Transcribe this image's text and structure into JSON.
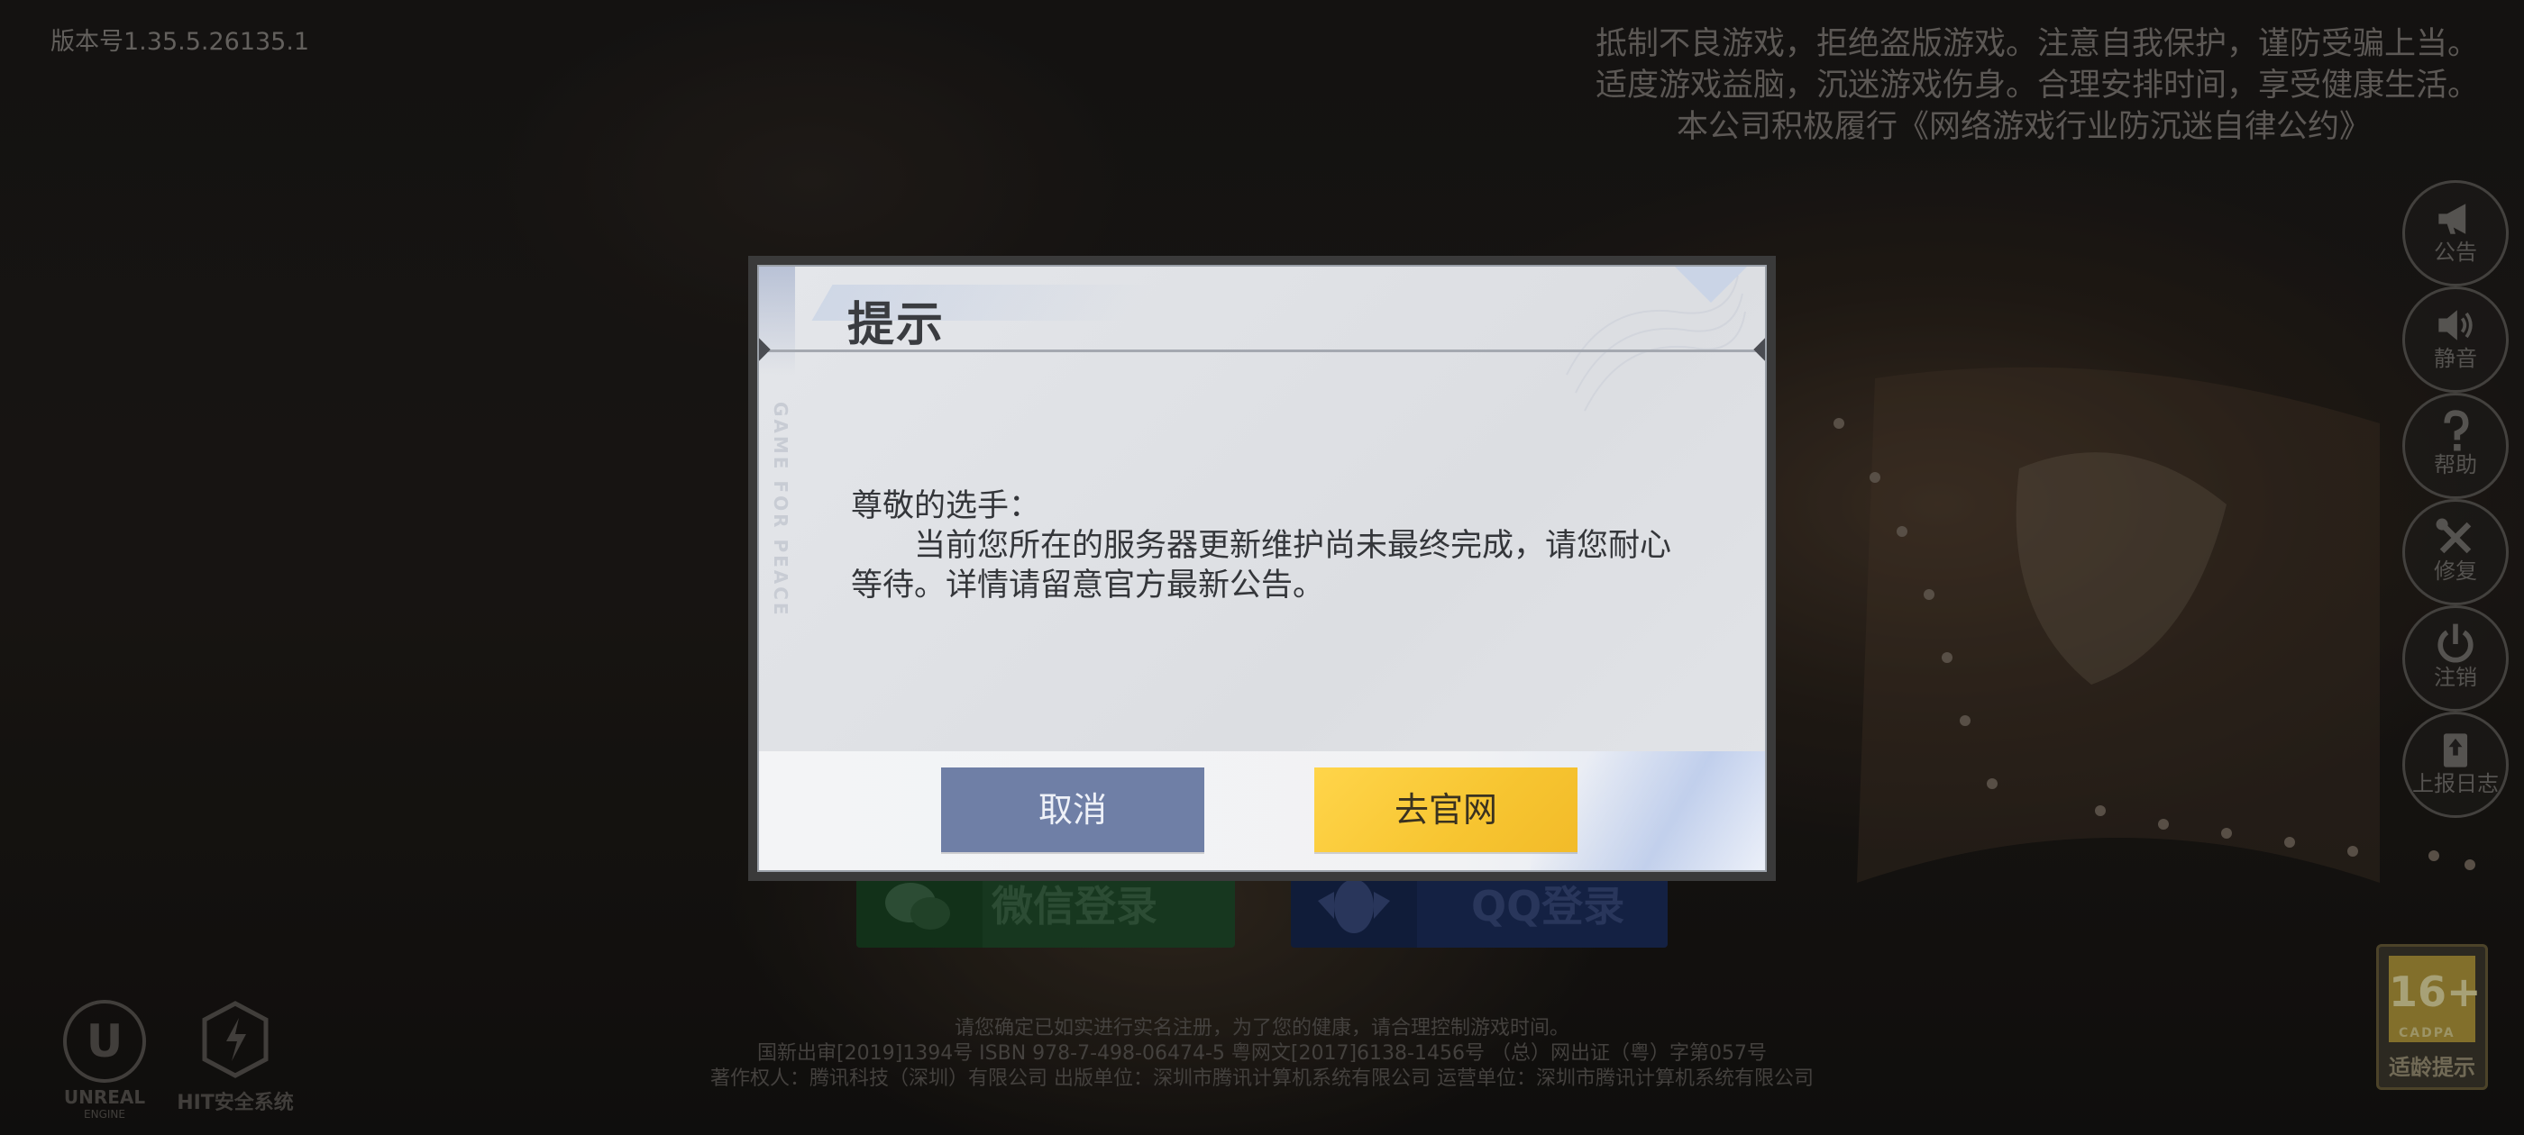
{
  "version": "版本号1.35.5.26135.1",
  "warning": {
    "line1": "抵制不良游戏，拒绝盗版游戏。注意自我保护，谨防受骗上当。",
    "line2": "适度游戏益脑，沉迷游戏伤身。合理安排时间，享受健康生活。",
    "line3": "本公司积极履行《网络游戏行业防沉迷自律公约》"
  },
  "side_menu": [
    {
      "label": "公告",
      "icon": "megaphone-icon"
    },
    {
      "label": "静音",
      "icon": "speaker-icon"
    },
    {
      "label": "帮助",
      "icon": "question-icon"
    },
    {
      "label": "修复",
      "icon": "wrench-icon"
    },
    {
      "label": "注销",
      "icon": "power-icon"
    },
    {
      "label": "上报日志",
      "icon": "upload-log-icon"
    }
  ],
  "age_badge": {
    "number": "16+",
    "sub": "CADPA",
    "label": "适龄提示"
  },
  "login": {
    "wechat": "微信登录",
    "qq": "QQ登录"
  },
  "logos": {
    "ue": "UNREAL",
    "ue_sub": "ENGINE",
    "hit": "HIT安全系统"
  },
  "footer": {
    "line1": "请您确定已如实进行实名注册，为了您的健康，请合理控制游戏时间。",
    "line2": "国新出审[2019]1394号  ISBN 978-7-498-06474-5  粤网文[2017]6138-1456号  （总）网出证（粤）字第057号",
    "line3": "著作权人：腾讯科技（深圳）有限公司   出版单位：深圳市腾讯计算机系统有限公司   运营单位：深圳市腾讯计算机系统有限公司"
  },
  "dialog": {
    "title": "提示",
    "deco_text": "GAME FOR PEACE",
    "greeting": "尊敬的选手：",
    "message": "当前您所在的服务器更新维护尚未最终完成，请您耐心等待。详情请留意官方最新公告。",
    "cancel_label": "取消",
    "official_label": "去官网"
  },
  "colors": {
    "cancel_button": "#6f7fa6",
    "official_button": "#f7c531",
    "dialog_bg": "#e2e4e8"
  }
}
